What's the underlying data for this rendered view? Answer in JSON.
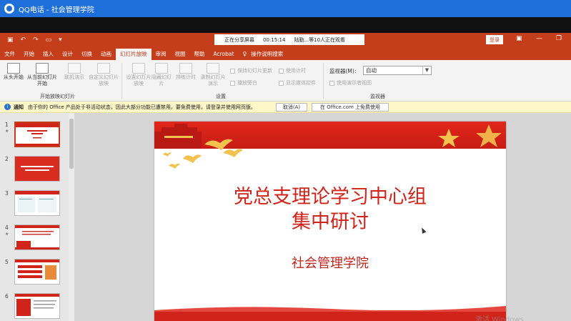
{
  "qq_window": {
    "title": "QQ电话 - 社会管理学院"
  },
  "ppt_window": {
    "share": {
      "status": "正在分享屏幕",
      "elapsed": "00:15:14",
      "viewers": "陆勤...等10人正在观看"
    },
    "login_label": "登录"
  },
  "ribbon": {
    "tabs": [
      "文件",
      "开始",
      "插入",
      "设计",
      "切换",
      "动画",
      "幻灯片放映",
      "审阅",
      "视图",
      "帮助",
      "Acrobat",
      "操作说明搜索"
    ],
    "active_tab": "幻灯片放映",
    "start_group": {
      "from_start": "从头开始",
      "from_current": "从当前幻灯片开始",
      "online": "联机演示",
      "custom": "自定义幻灯片放映",
      "label": "开始放映幻灯片"
    },
    "setup_group": {
      "setup_show": "设置幻灯片放映",
      "hide_slide": "隐藏幻灯片",
      "rehearse": "排练计时",
      "record": "录制幻灯片演示",
      "play_narration": "播放旁白",
      "use_timings": "使用计时",
      "show_media_controls": "显示媒体控件",
      "keep_updated": "保持幻灯片更新",
      "label": "设置"
    },
    "monitor_group": {
      "monitor_label": "监视器(M):",
      "monitor_value": "自动",
      "presenter_view": "使用演示者视图",
      "label": "监视器"
    }
  },
  "notification": {
    "title": "通知",
    "message": "由于你的 Office 产品处于非活动状态，因此大部分功能已遭禁用。要免费使用，请登录并使用网页版。",
    "dismiss_label": "取消(A)",
    "free_label": "在 Office.com 上免费使用"
  },
  "slide_thumbnails": [
    {
      "number": "1",
      "star": "★"
    },
    {
      "number": "2",
      "star": ""
    },
    {
      "number": "3",
      "star": ""
    },
    {
      "number": "4",
      "star": "★"
    },
    {
      "number": "5",
      "star": ""
    },
    {
      "number": "6",
      "star": ""
    }
  ],
  "slide": {
    "title_line1": "党总支理论学习中心组",
    "title_line2": "集中研讨",
    "subtitle": "社会管理学院"
  },
  "watermark": "激活 Windows",
  "colors": {
    "ppt_red": "#c43e1c",
    "qq_blue": "#1e6fd9",
    "slide_red": "#d0241b"
  }
}
